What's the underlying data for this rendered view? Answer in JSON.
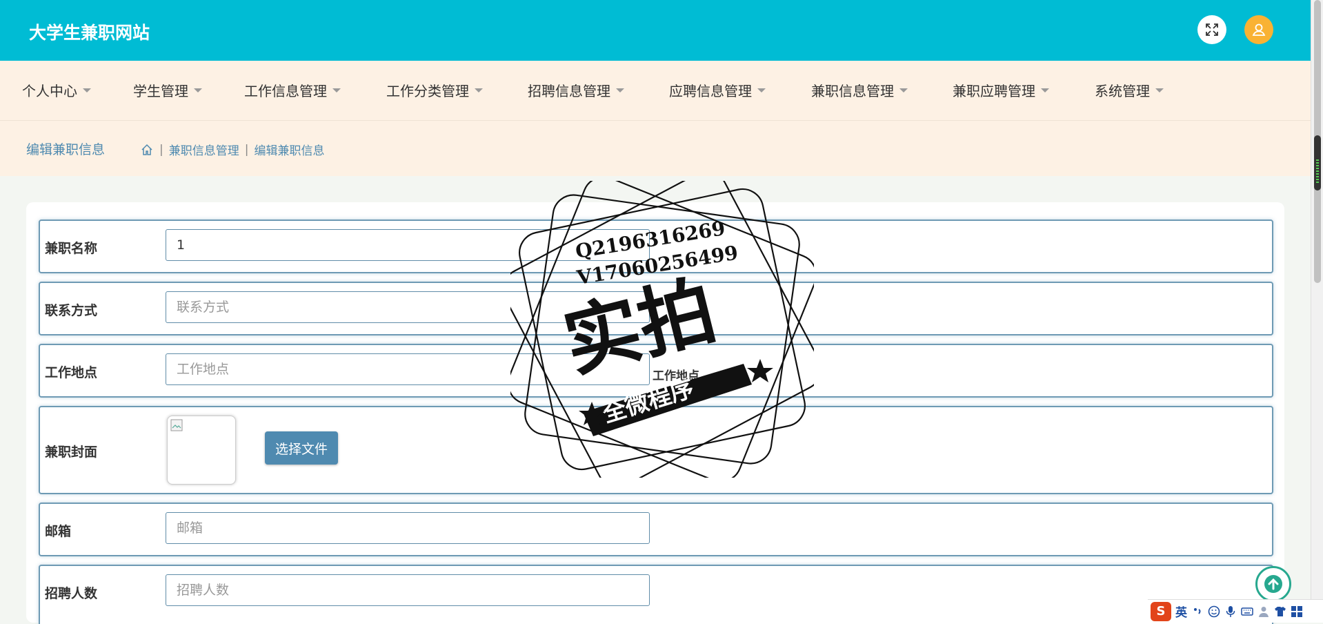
{
  "header": {
    "site_title": "大学生兼职网站",
    "fullscreen_icon": "expand-icon",
    "user_icon": "user-avatar-icon",
    "accent": "#00bcd4"
  },
  "nav": {
    "items": [
      {
        "label": "个人中心"
      },
      {
        "label": "学生管理"
      },
      {
        "label": "工作信息管理"
      },
      {
        "label": "工作分类管理"
      },
      {
        "label": "招聘信息管理"
      },
      {
        "label": "应聘信息管理"
      },
      {
        "label": "兼职信息管理"
      },
      {
        "label": "兼职应聘管理"
      },
      {
        "label": "系统管理"
      }
    ]
  },
  "breadcrumb": {
    "page_title": "编辑兼职信息",
    "home_icon": "home-icon",
    "level1": "兼职信息管理",
    "level2": "编辑兼职信息"
  },
  "form": {
    "name": {
      "label": "兼职名称",
      "value": "1",
      "placeholder": "兼职名称"
    },
    "contact": {
      "label": "联系方式",
      "value": "",
      "placeholder": "联系方式"
    },
    "location": {
      "label": "工作地点",
      "value": "",
      "placeholder": "工作地点",
      "hint": "工作地点"
    },
    "cover": {
      "label": "兼职封面",
      "button_label": "选择文件"
    },
    "email": {
      "label": "邮箱",
      "value": "",
      "placeholder": "邮箱"
    },
    "headcount": {
      "label": "招聘人数",
      "value": "",
      "placeholder": "招聘人数"
    }
  },
  "watermark": {
    "line1": "Q2196316269",
    "line2": "V17060256499",
    "big": "实拍",
    "banner": "全微程序"
  },
  "ime": {
    "logo": "S",
    "lang": "英"
  }
}
